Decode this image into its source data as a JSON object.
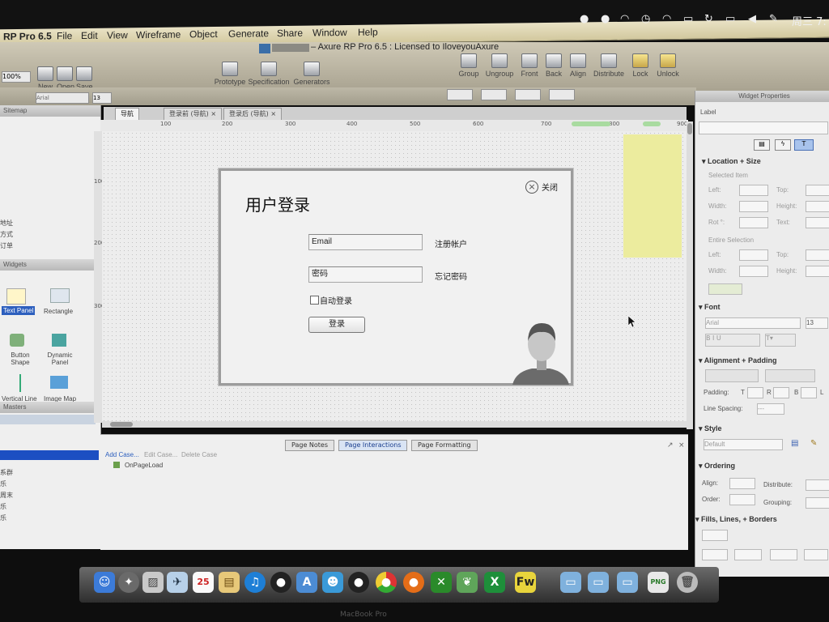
{
  "menubar": {
    "app": "RP Pro 6.5",
    "items": [
      "File",
      "Edit",
      "View",
      "Wireframe",
      "Object",
      "Generate",
      "Share",
      "Window",
      "Help"
    ],
    "tray_text": "周三 7:"
  },
  "window": {
    "title": "– Axure RP Pro 6.5 : Licensed to IloveyouAxure"
  },
  "toolbar": {
    "zoom": "100%",
    "left_buttons": [
      "New",
      "Open",
      "Save"
    ],
    "center_buttons": [
      "Prototype",
      "Specification",
      "Generators"
    ],
    "right_buttons": [
      "Group",
      "Ungroup",
      "Front",
      "Back",
      "Align",
      "Distribute",
      "Lock",
      "Unlock"
    ],
    "font_name": "Arial",
    "font_size": "13"
  },
  "left": {
    "sitemap_title": "Sitemap",
    "sitemap_items": [
      "地址",
      "方式",
      "订单"
    ],
    "widgets_title": "Widgets",
    "widgets": [
      "Text Panel",
      "Rectangle",
      "Button Shape",
      "Dynamic Panel",
      "Vertical Line",
      "Image Map"
    ],
    "masters_title": "Masters",
    "masters_items": [
      "系群",
      "乐",
      "周末",
      "乐",
      "乐"
    ]
  },
  "tabs": [
    {
      "label": "导航"
    },
    {
      "label": "登录前 (导航)"
    },
    {
      "label": "登录后 (导航)"
    }
  ],
  "ruler_top": [
    "100",
    "200",
    "300",
    "400",
    "500",
    "600",
    "700",
    "800",
    "900"
  ],
  "ruler_side": [
    "100",
    "200",
    "300"
  ],
  "dialog": {
    "title": "用户登录",
    "close_label": "关闭",
    "email_value": "Email",
    "register_link": "注册帐户",
    "password_value": "密码",
    "forgot_link": "忘记密码",
    "remember_label": "自动登录",
    "login_button": "登录"
  },
  "bottom": {
    "tabs": [
      "Page Notes",
      "Page Interactions",
      "Page Formatting"
    ],
    "actions": [
      "Add Case...",
      "Edit Case...",
      "Delete Case"
    ],
    "event": "OnPageLoad"
  },
  "right": {
    "title": "Widget Properties",
    "label_field": "Label",
    "location_title": "Location + Size",
    "selected_item": "Selected Item",
    "entire_selection": "Entire Selection",
    "left": "Left:",
    "top": "Top:",
    "width": "Width:",
    "height": "Height:",
    "rot": "Rot °:",
    "text": "Text:",
    "font_title": "Font",
    "font_name": "Arial",
    "font_size": "13",
    "align_title": "Alignment + Padding",
    "padding": "Padding:",
    "pad_t": "T",
    "pad_r": "R",
    "pad_b": "B",
    "pad_l": "L",
    "line_spacing": "Line Spacing:",
    "line_spacing_value": "---",
    "style_title": "Style",
    "style_value": "Default",
    "ordering_title": "Ordering",
    "align_label": "Align:",
    "distribute_label": "Distribute:",
    "order_label": "Order:",
    "grouping_label": "Grouping:",
    "fills_title": "Fills, Lines, + Borders"
  },
  "dock": {
    "calendar_day": "25",
    "fw_label": "Fw",
    "png_label": "PNG"
  },
  "brand_text": "MacBook Pro"
}
